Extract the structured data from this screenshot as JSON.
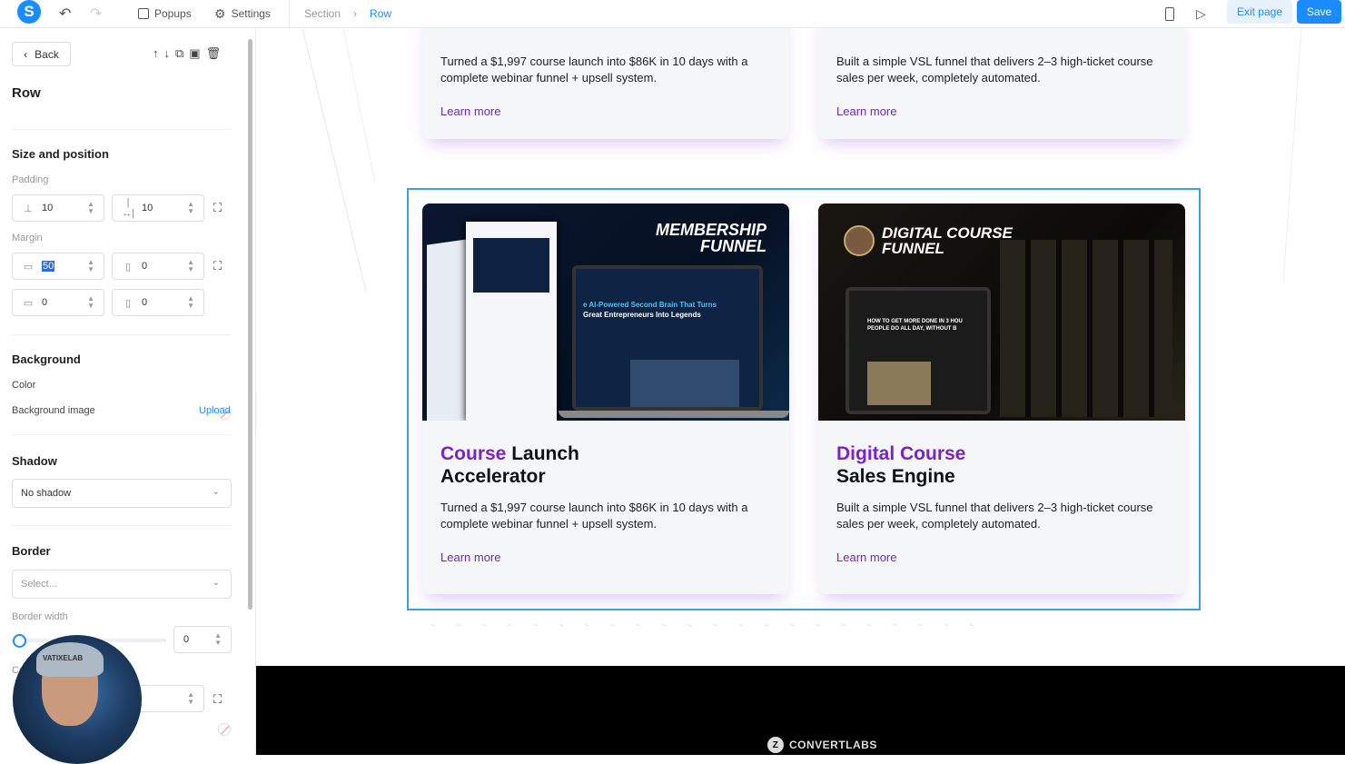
{
  "topbar": {
    "logo": "S",
    "undo_icon": "undo-icon",
    "redo_icon": "redo-icon",
    "popups": "Popups",
    "settings": "Settings",
    "breadcrumb": [
      "Section",
      "Row"
    ],
    "breadcrumb_sep": "›",
    "exit": "Exit page",
    "save": "Save",
    "accent": "#1a8cff"
  },
  "sidebar": {
    "back": "Back",
    "title": "Row",
    "size_position": "Size and position",
    "padding_label": "Padding",
    "padding_vertical": "10",
    "padding_horizontal": "10",
    "margin_label": "Margin",
    "margin_top": "50",
    "margin_left": "0",
    "margin_bottom": "0",
    "margin_right": "0",
    "background": "Background",
    "color_label": "Color",
    "bg_image_label": "Background image",
    "upload": "Upload",
    "shadow": "Shadow",
    "shadow_value": "No shadow",
    "border": "Border",
    "border_placeholder": "Select...",
    "border_width_label": "Border width",
    "border_width_value": "0",
    "corner_label": "Corner",
    "webcam_cap_text": "VATIXELAB"
  },
  "canvas": {
    "top_cards": [
      {
        "desc": "Turned a $1,997 course launch into $86K in 10 days with a complete webinar funnel + upsell system.",
        "more": "Learn more"
      },
      {
        "desc": "Built a simple VSL funnel that delivers 2–3 high-ticket course sales per week, completely automated.",
        "more": "Learn more"
      }
    ],
    "cards": [
      {
        "image_heading": [
          "MEMBERSHIP",
          "FUNNEL"
        ],
        "screen_text": [
          "e AI-Powered Second Brain That Turns",
          "Great Entrepreneurs Into Legends"
        ],
        "title_accent": "Course",
        "title_rest": " Launch",
        "title_line2": "Accelerator",
        "desc": "Turned a $1,997 course launch into $86K in 10 days with a complete webinar funnel + upsell system.",
        "more": "Learn more"
      },
      {
        "image_heading": [
          "DIGITAL COURSE",
          "FUNNEL"
        ],
        "screen_text": [
          "HOW TO GET MORE DONE IN 3 HOU",
          "PEOPLE DO ALL DAY, WITHOUT B"
        ],
        "title_accent": "Digital Course",
        "title_line2": "Sales Engine",
        "desc": "Built a simple VSL funnel that delivers 2–3 high-ticket course sales per week, completely automated.",
        "more": "Learn more"
      }
    ],
    "title_accent_color": "#7b22c8",
    "selection_color": "#3aa0e8"
  },
  "footer": {
    "brand": "CONVERTLABS",
    "mark": "Z"
  }
}
